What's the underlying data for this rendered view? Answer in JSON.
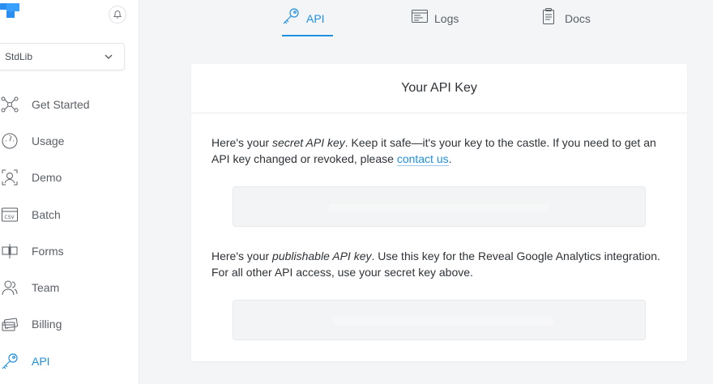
{
  "sidebar": {
    "org_select": {
      "value": "StdLib"
    },
    "items": [
      {
        "label": "Get Started",
        "icon": "network-icon"
      },
      {
        "label": "Usage",
        "icon": "gauge-icon"
      },
      {
        "label": "Demo",
        "icon": "face-scan-icon"
      },
      {
        "label": "Batch",
        "icon": "csv-file-icon"
      },
      {
        "label": "Forms",
        "icon": "form-icon"
      },
      {
        "label": "Team",
        "icon": "team-icon"
      },
      {
        "label": "Billing",
        "icon": "credit-card-icon"
      },
      {
        "label": "API",
        "icon": "key-icon",
        "active": true
      }
    ]
  },
  "tabs": [
    {
      "label": "API",
      "icon": "key-icon",
      "active": true
    },
    {
      "label": "Logs",
      "icon": "logs-window-icon"
    },
    {
      "label": "Docs",
      "icon": "document-icon"
    }
  ],
  "card": {
    "title": "Your API Key",
    "secret": {
      "text_before": "Here's your ",
      "emphasis": "secret API key",
      "text_after": ". Keep it safe—it's your key to the castle. If you need to get an API key changed or revoked, please ",
      "link": "contact us",
      "text_end": "."
    },
    "publishable": {
      "text_before": "Here's your ",
      "emphasis": "publishable API key",
      "text_after": ". Use this key for the Reveal Google Analytics integration. For all other API access, use your secret key above."
    }
  },
  "colors": {
    "accent": "#1f8fe0",
    "logo": "#2a8ff0"
  }
}
